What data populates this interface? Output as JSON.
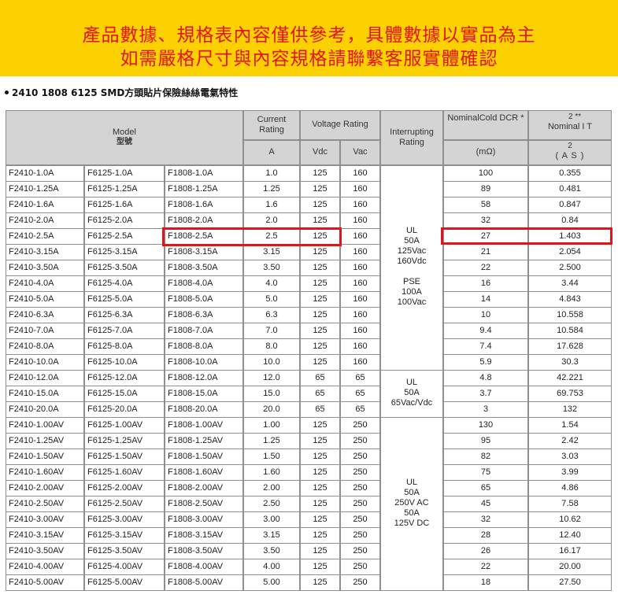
{
  "banner": {
    "line1": "產品數據、規格表內容僅供參考，具體數據以實品為主",
    "line2": "如需嚴格尺寸與內容規格請聯繫客服實體確認"
  },
  "section_title": "2410 1808 6125 SMD方頭貼片保險絲絲電氣特性",
  "colors": {
    "banner_bg": "#fcd101",
    "banner_text": "#e3141a",
    "header_bg": "#d4d4d4",
    "highlight": "#e0141a"
  },
  "headers": {
    "model": "Model",
    "model_zh": "型號",
    "current_rating": "Current Rating",
    "current_unit": "A",
    "voltage_rating": "Voltage Rating",
    "vdc": "Vdc",
    "vac": "Vac",
    "interrupting_rating": "Interrupting Rating",
    "dcr": "NominalCold DCR *",
    "dcr_unit": "(mΩ)",
    "i2t_sup": "2 **",
    "i2t_label": "Nominal I T",
    "i2t_unit_sup": "2",
    "i2t_unit": "( A S )"
  },
  "rows": [
    [
      "F2410-1.0A",
      "F6125-1.0A",
      "F1808-1.0A",
      "1.0",
      "125",
      "160",
      "100",
      "0.355"
    ],
    [
      "F2410-1.25A",
      "F6125-1.25A",
      "F1808-1.25A",
      "1.25",
      "125",
      "160",
      "89",
      "0.481"
    ],
    [
      "F2410-1.6A",
      "F6125-1.6A",
      "F1808-1.6A",
      "1.6",
      "125",
      "160",
      "58",
      "0.847"
    ],
    [
      "F2410-2.0A",
      "F6125-2.0A",
      "F1808-2.0A",
      "2.0",
      "125",
      "160",
      "32",
      "0.84"
    ],
    [
      "F2410-2.5A",
      "F6125-2.5A",
      "F1808-2.5A",
      "2.5",
      "125",
      "160",
      "27",
      "1.403"
    ],
    [
      "F2410-3.15A",
      "F6125-3.15A",
      "F1808-3.15A",
      "3.15",
      "125",
      "160",
      "21",
      "2.054"
    ],
    [
      "F2410-3.50A",
      "F6125-3.50A",
      "F1808-3.50A",
      "3.50",
      "125",
      "160",
      "22",
      "2.500"
    ],
    [
      "F2410-4.0A",
      "F6125-4.0A",
      "F1808-4.0A",
      "4.0",
      "125",
      "160",
      "16",
      "3.44"
    ],
    [
      "F2410-5.0A",
      "F6125-5.0A",
      "F1808-5.0A",
      "5.0",
      "125",
      "160",
      "14",
      "4.843"
    ],
    [
      "F2410-6.3A",
      "F6125-6.3A",
      "F1808-6.3A",
      "6.3",
      "125",
      "160",
      "10",
      "10.558"
    ],
    [
      "F2410-7.0A",
      "F6125-7.0A",
      "F1808-7.0A",
      "7.0",
      "125",
      "160",
      "9.4",
      "10.584"
    ],
    [
      "F2410-8.0A",
      "F6125-8.0A",
      "F1808-8.0A",
      "8.0",
      "125",
      "160",
      "7.4",
      "17.628"
    ],
    [
      "F2410-10.0A",
      "F6125-10.0A",
      "F1808-10.0A",
      "10.0",
      "125",
      "160",
      "5.9",
      "30.3"
    ],
    [
      "F2410-12.0A",
      "F6125-12.0A",
      "F1808-12.0A",
      "12.0",
      "65",
      "65",
      "4.8",
      "42.221"
    ],
    [
      "F2410-15.0A",
      "F6125-15.0A",
      "F1808-15.0A",
      "15.0",
      "65",
      "65",
      "3.7",
      "69.753"
    ],
    [
      "F2410-20.0A",
      "F6125-20.0A",
      "F1808-20.0A",
      "20.0",
      "65",
      "65",
      "3",
      "132"
    ],
    [
      "F2410-1.00AV",
      "F6125-1.00AV",
      "F1808-1.00AV",
      "1.00",
      "125",
      "250",
      "130",
      "1.54"
    ],
    [
      "F2410-1.25AV",
      "F6125-1.25AV",
      "F1808-1.25AV",
      "1.25",
      "125",
      "250",
      "95",
      "2.42"
    ],
    [
      "F2410-1.50AV",
      "F6125-1.50AV",
      "F1808-1.50AV",
      "1.50",
      "125",
      "250",
      "82",
      "3.03"
    ],
    [
      "F2410-1.60AV",
      "F6125-1.60AV",
      "F1808-1.60AV",
      "1.60",
      "125",
      "250",
      "75",
      "3.99"
    ],
    [
      "F2410-2.00AV",
      "F6125-2.00AV",
      "F1808-2.00AV",
      "2.00",
      "125",
      "250",
      "65",
      "4.86"
    ],
    [
      "F2410-2.50AV",
      "F6125-2.50AV",
      "F1808-2.50AV",
      "2.50",
      "125",
      "250",
      "45",
      "7.58"
    ],
    [
      "F2410-3.00AV",
      "F6125-3.00AV",
      "F1808-3.00AV",
      "3.00",
      "125",
      "250",
      "32",
      "10.62"
    ],
    [
      "F2410-3.15AV",
      "F6125-3.15AV",
      "F1808-3.15AV",
      "3.15",
      "125",
      "250",
      "28",
      "12.40"
    ],
    [
      "F2410-3.50AV",
      "F6125-3.50AV",
      "F1808-3.50AV",
      "3.50",
      "125",
      "250",
      "26",
      "16.17"
    ],
    [
      "F2410-4.00AV",
      "F6125-4.00AV",
      "F1808-4.00AV",
      "4.00",
      "125",
      "250",
      "22",
      "20.00"
    ],
    [
      "F2410-5.00AV",
      "F6125-5.00AV",
      "F1808-5.00AV",
      "5.00",
      "125",
      "250",
      "18",
      "27.50"
    ]
  ],
  "interrupting_groups": [
    {
      "lines": [
        "UL",
        "50A",
        "125Vac",
        "160Vdc",
        "",
        "PSE",
        "100A",
        "100Vac"
      ]
    },
    {
      "lines": [
        "UL",
        "50A",
        "65Vac/Vdc"
      ]
    },
    {
      "lines": [
        "UL",
        "50A",
        "250V AC",
        "50A",
        "125V DC"
      ]
    }
  ],
  "highlighted_row": "F2410-2.5A"
}
